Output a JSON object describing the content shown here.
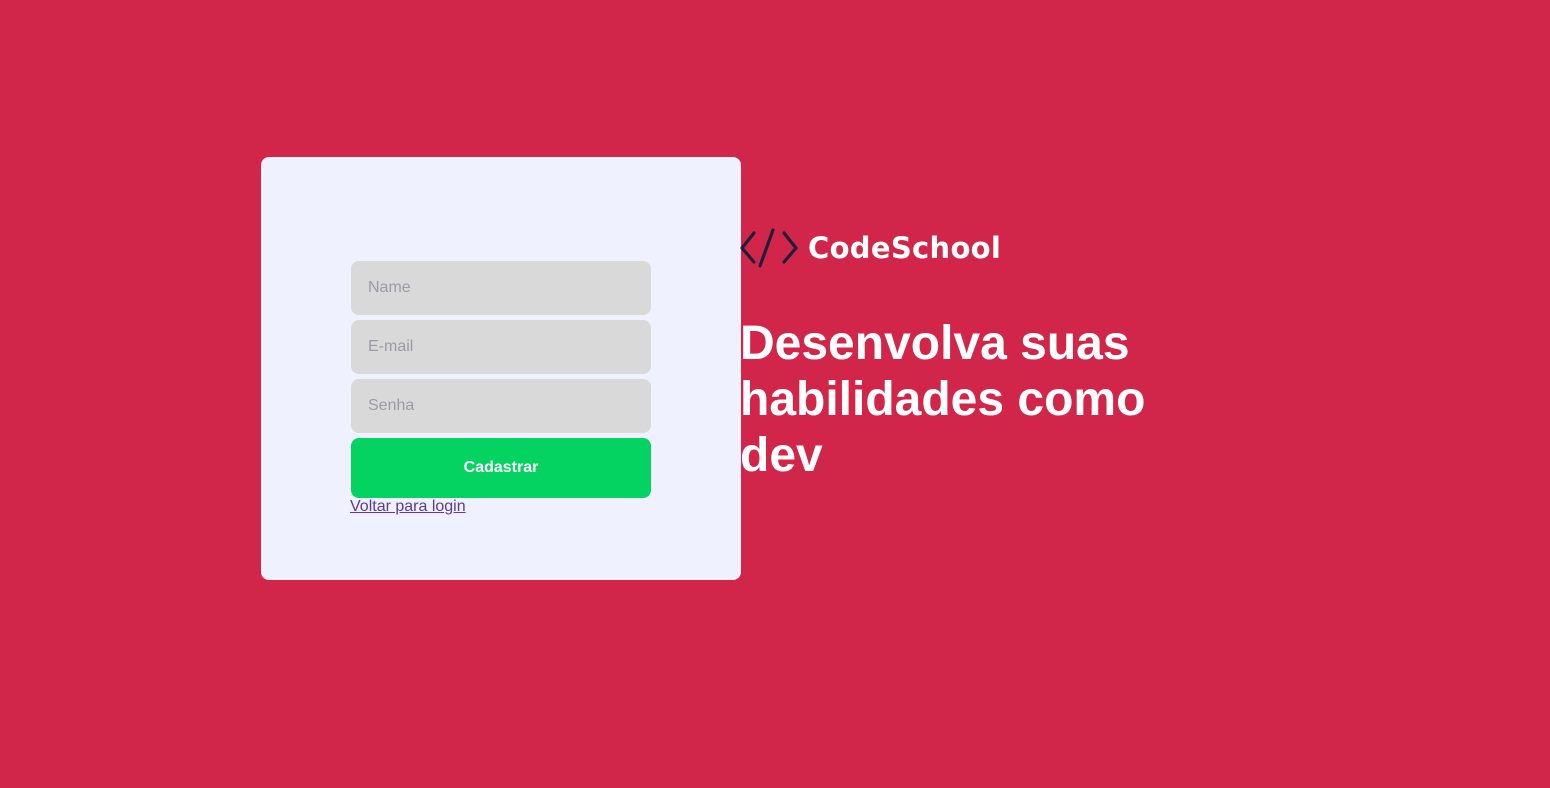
{
  "colors": {
    "background": "#d12549",
    "card": "#eff1fe",
    "field": "#d9d9d9",
    "button": "#04d361",
    "link": "#5f3a8f",
    "icon": "#1f1f3a",
    "text_light": "#ffffff"
  },
  "form": {
    "name_placeholder": "Name",
    "email_placeholder": "E-mail",
    "password_placeholder": "Senha",
    "submit_label": "Cadastrar",
    "back_link_label": "Voltar para login"
  },
  "brand": {
    "icon": "code-brackets-icon",
    "name": "CodeSchool"
  },
  "hero": {
    "headline": "Desenvolva suas habilidades como dev"
  }
}
